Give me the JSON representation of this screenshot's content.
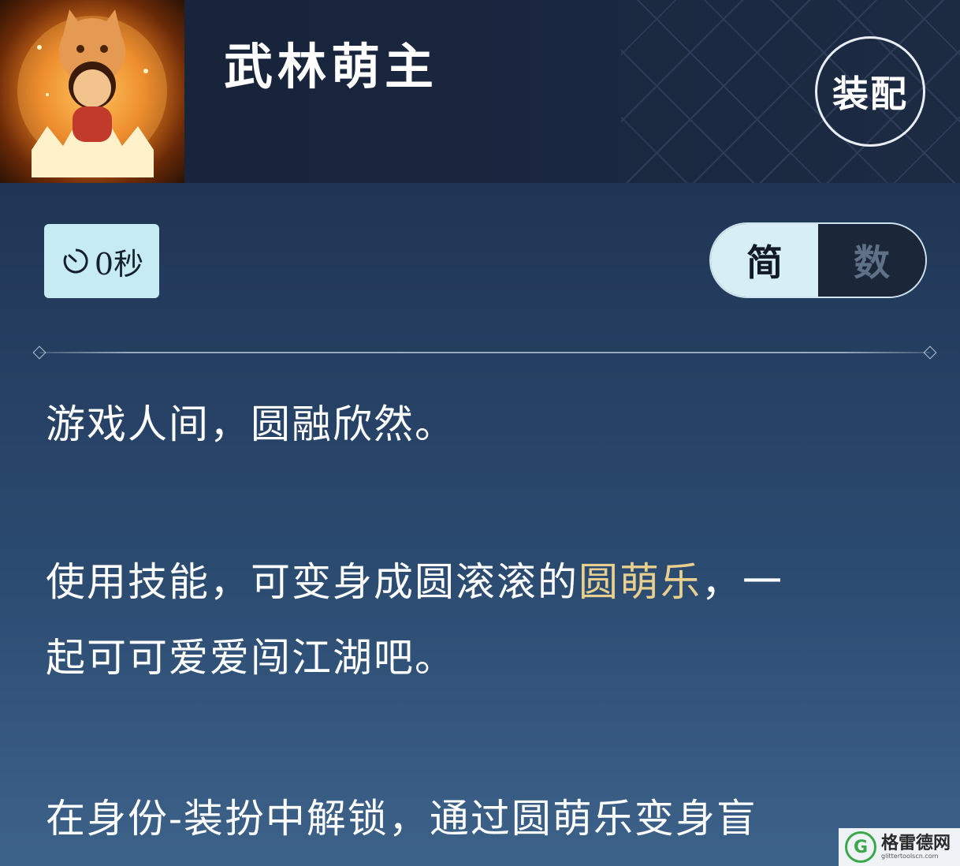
{
  "header": {
    "title": "武林萌主",
    "equip_button": "装配",
    "icon": "cat-mascot-icon"
  },
  "cooldown": {
    "icon": "timer-icon",
    "value": "0秒"
  },
  "view_toggle": {
    "options": [
      "简",
      "数"
    ],
    "selected": "简"
  },
  "description": {
    "line1": "游戏人间，圆融欣然。",
    "line2_before": "使用技能，可变身成圆滚滚的",
    "line2_highlight": "圆萌乐",
    "line2_after": "，一",
    "line3": "起可可爱爱闯江湖吧。",
    "line4": "在身份-装扮中解锁，通过圆萌乐变身盲"
  },
  "watermark": {
    "logo_letter": "G",
    "name": "格雷德网",
    "url": "glittertoolscn.com"
  },
  "colors": {
    "highlight": "#e8cf8f",
    "badge_bg": "#c6ebf2",
    "toggle_on": "#d7eef4",
    "toggle_off": "#1b2638"
  }
}
